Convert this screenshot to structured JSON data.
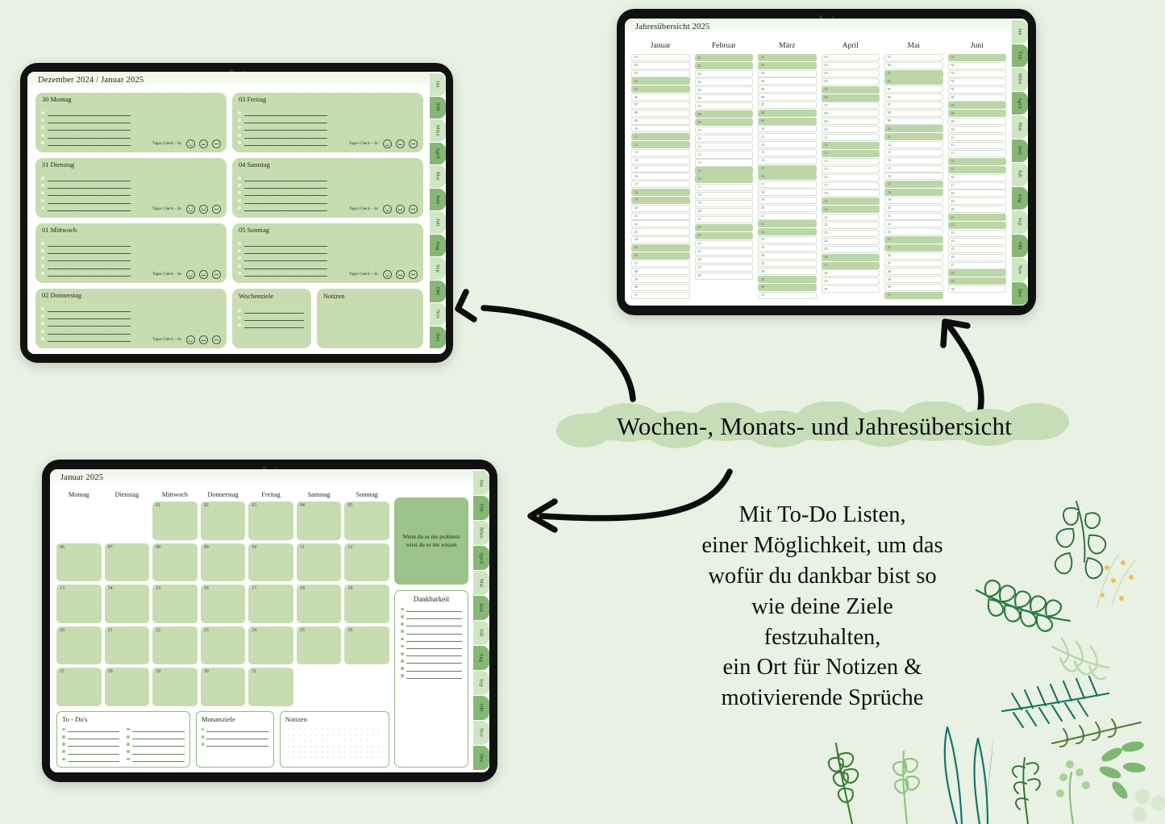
{
  "background_color": "#e8f1e3",
  "accent_green": "#c8dcb2",
  "accent_green_dark": "#9cc389",
  "marketing": {
    "headline": "Wochen-, Monats- und Jahresübersicht",
    "body_lines": [
      "Mit To-Do Listen,",
      "einer Möglichkeit, um das",
      "wofür du dankbar bist so",
      "wie deine Ziele",
      "festzuhalten,",
      "ein Ort für Notizen &",
      "motivierende Sprüche"
    ]
  },
  "month_tabs": [
    "Jan",
    "Feb",
    "März",
    "April",
    "Mai",
    "Juni",
    "Juli",
    "Aug",
    "Sep",
    "Okt",
    "Nov",
    "Dez"
  ],
  "weekly": {
    "title": "Dezember 2024 / Januar 2025",
    "checkin_label": "Tages Check – In:",
    "days_left": [
      "30 Montag",
      "31 Dienstag",
      "01 Mittwoch",
      "02 Donnerstag"
    ],
    "days_right": [
      "03 Freitag",
      "04 Samstag",
      "05 Sonntag"
    ],
    "weekly_goals_label": "Wochenziele",
    "notes_label": "Notizen"
  },
  "yearly": {
    "title": "Jahresübersicht 2025",
    "months": [
      {
        "name": "Januar",
        "days": [
          "01",
          "02",
          "03",
          "04",
          "05",
          "06",
          "07",
          "08",
          "09",
          "10",
          "11",
          "12",
          "13",
          "14",
          "15",
          "16",
          "17",
          "18",
          "19",
          "20",
          "21",
          "22",
          "23",
          "24",
          "25",
          "26",
          "27",
          "28",
          "29",
          "30",
          "31"
        ],
        "weekend_days": [
          4,
          5,
          11,
          12,
          18,
          19,
          25,
          26
        ]
      },
      {
        "name": "Februar",
        "days": [
          "01",
          "02",
          "03",
          "04",
          "05",
          "06",
          "07",
          "08",
          "09",
          "10",
          "11",
          "12",
          "13",
          "14",
          "15",
          "16",
          "17",
          "18",
          "19",
          "20",
          "21",
          "22",
          "23",
          "24",
          "25",
          "26",
          "27",
          "28"
        ],
        "weekend_days": [
          1,
          2,
          8,
          9,
          15,
          16,
          22,
          23
        ]
      },
      {
        "name": "März",
        "days": [
          "01",
          "02",
          "03",
          "04",
          "05",
          "06",
          "07",
          "08",
          "09",
          "10",
          "11",
          "12",
          "13",
          "14",
          "15",
          "16",
          "17",
          "18",
          "19",
          "20",
          "21",
          "22",
          "23",
          "24",
          "25",
          "26",
          "27",
          "28",
          "29",
          "30",
          "31"
        ],
        "weekend_days": [
          1,
          2,
          8,
          9,
          15,
          16,
          22,
          23,
          29,
          30
        ]
      },
      {
        "name": "April",
        "days": [
          "01",
          "02",
          "03",
          "04",
          "05",
          "06",
          "07",
          "08",
          "09",
          "10",
          "11",
          "12",
          "13",
          "14",
          "15",
          "16",
          "17",
          "18",
          "19",
          "20",
          "21",
          "22",
          "23",
          "24",
          "25",
          "26",
          "27",
          "28",
          "29",
          "30"
        ],
        "weekend_days": [
          5,
          6,
          12,
          13,
          19,
          20,
          26,
          27
        ]
      },
      {
        "name": "Mai",
        "days": [
          "01",
          "02",
          "03",
          "04",
          "05",
          "06",
          "07",
          "08",
          "09",
          "10",
          "11",
          "12",
          "13",
          "14",
          "15",
          "16",
          "17",
          "18",
          "19",
          "20",
          "21",
          "22",
          "23",
          "24",
          "25",
          "26",
          "27",
          "28",
          "29",
          "30",
          "31"
        ],
        "weekend_days": [
          3,
          4,
          10,
          11,
          17,
          18,
          24,
          25,
          31
        ]
      },
      {
        "name": "Juni",
        "days": [
          "01",
          "02",
          "03",
          "04",
          "05",
          "06",
          "07",
          "08",
          "09",
          "10",
          "11",
          "12",
          "13",
          "14",
          "15",
          "16",
          "17",
          "18",
          "19",
          "20",
          "21",
          "22",
          "23",
          "24",
          "25",
          "26",
          "27",
          "28",
          "29",
          "30"
        ],
        "weekend_days": [
          1,
          7,
          8,
          14,
          15,
          21,
          22,
          28,
          29
        ]
      }
    ]
  },
  "monthly": {
    "title": "Januar 2025",
    "weekday_headers": [
      "Montag",
      "Dienstag",
      "Mittwoch",
      "Donnerstag",
      "Freitag",
      "Samstag",
      "Sonntag"
    ],
    "leading_blanks": 2,
    "day_numbers": [
      "01",
      "02",
      "03",
      "04",
      "05",
      "06",
      "07",
      "08",
      "09",
      "10",
      "11",
      "12",
      "13",
      "14",
      "15",
      "16",
      "17",
      "18",
      "19",
      "20",
      "21",
      "22",
      "23",
      "24",
      "25",
      "26",
      "27",
      "28",
      "29",
      "30",
      "31"
    ],
    "quote": "Wenn du es nie probierst wirst du es nie wissen",
    "gratitude_label": "Dankbarkeit",
    "gratitude_line_count": 10,
    "todo_label": "To - Do's",
    "todo_line_count": 5,
    "monthly_goals_label": "Monatsziele",
    "monthly_goals_line_count": 3,
    "notes_label": "Notizen"
  }
}
